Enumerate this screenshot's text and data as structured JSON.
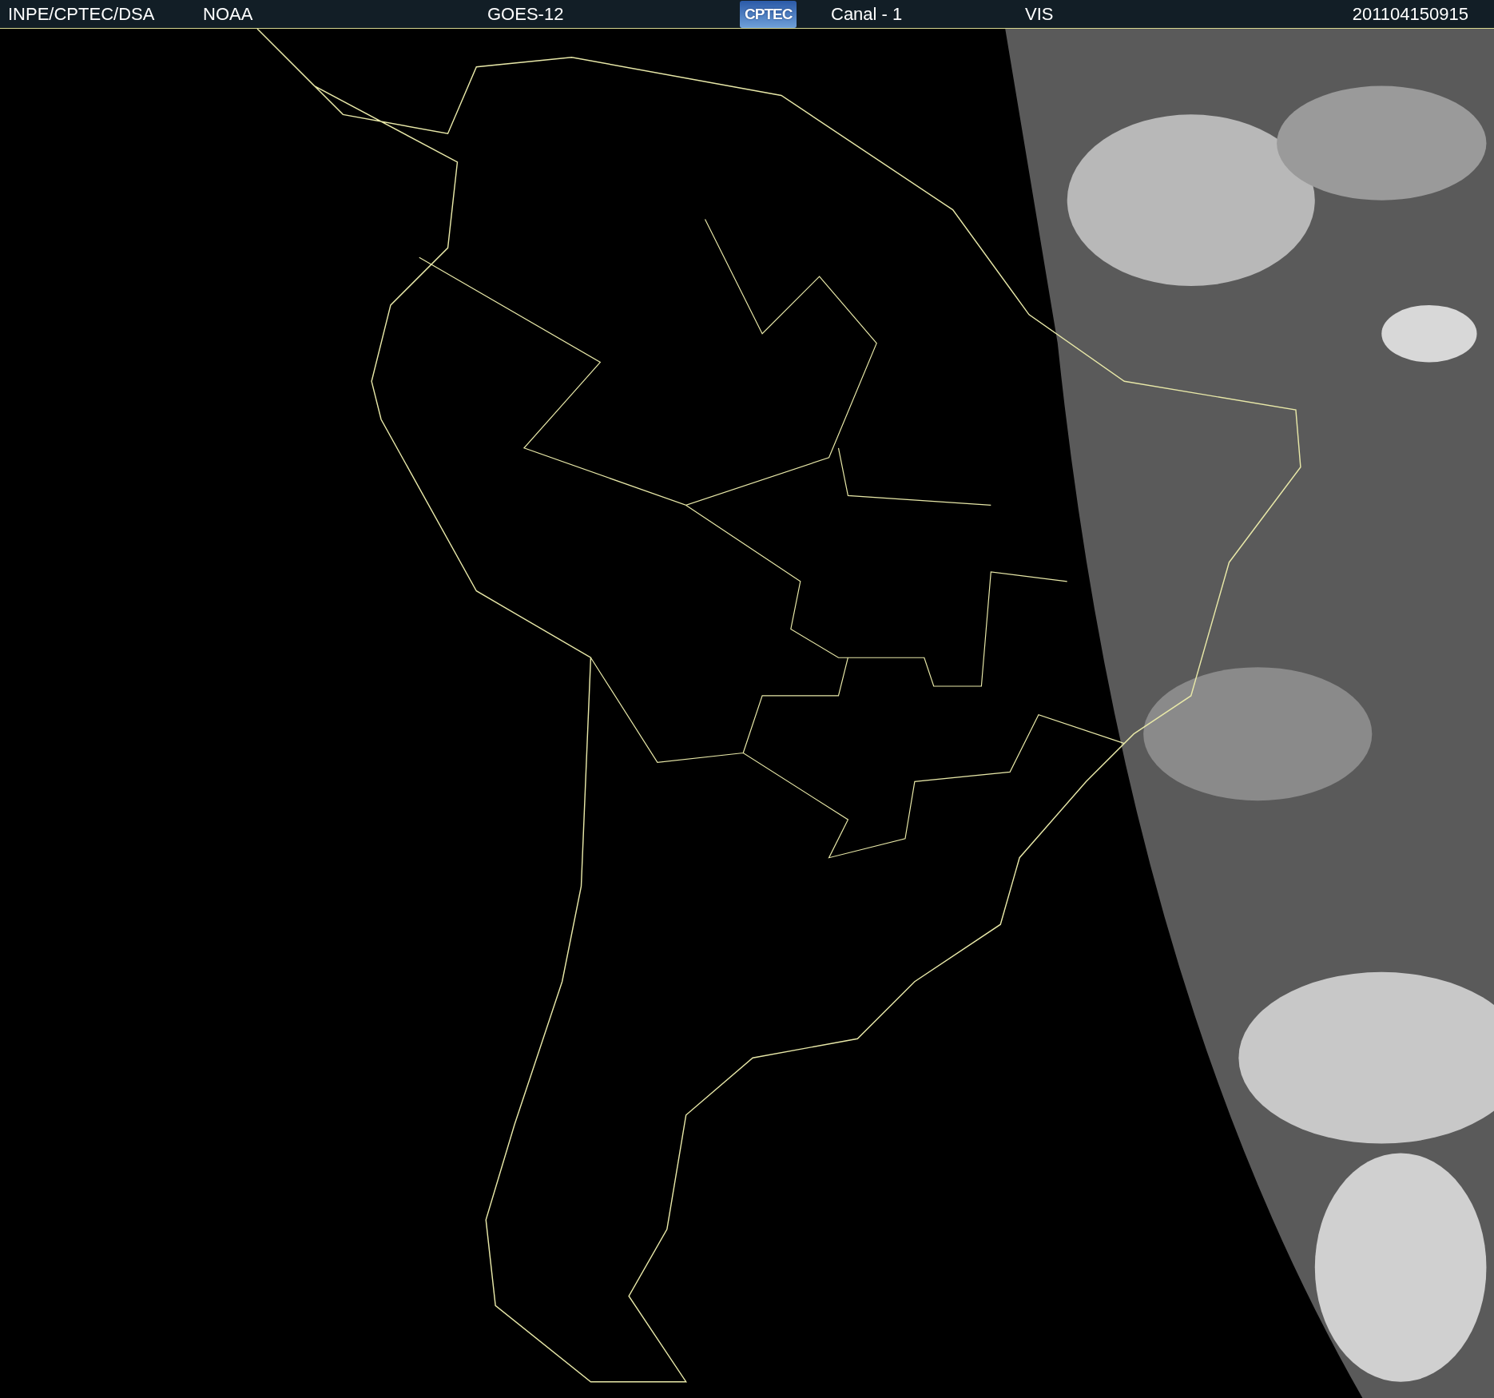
{
  "header": {
    "items": [
      {
        "kind": "text",
        "text": "INPE/CPTEC/DSA"
      },
      {
        "kind": "text",
        "text": "NOAA"
      },
      {
        "kind": "text",
        "text": "GOES-12"
      },
      {
        "kind": "logo",
        "text": "CPTEC"
      },
      {
        "kind": "text",
        "text": "Canal - 1"
      },
      {
        "kind": "text",
        "text": "VIS"
      },
      {
        "kind": "text",
        "text": "201104150915"
      }
    ]
  }
}
